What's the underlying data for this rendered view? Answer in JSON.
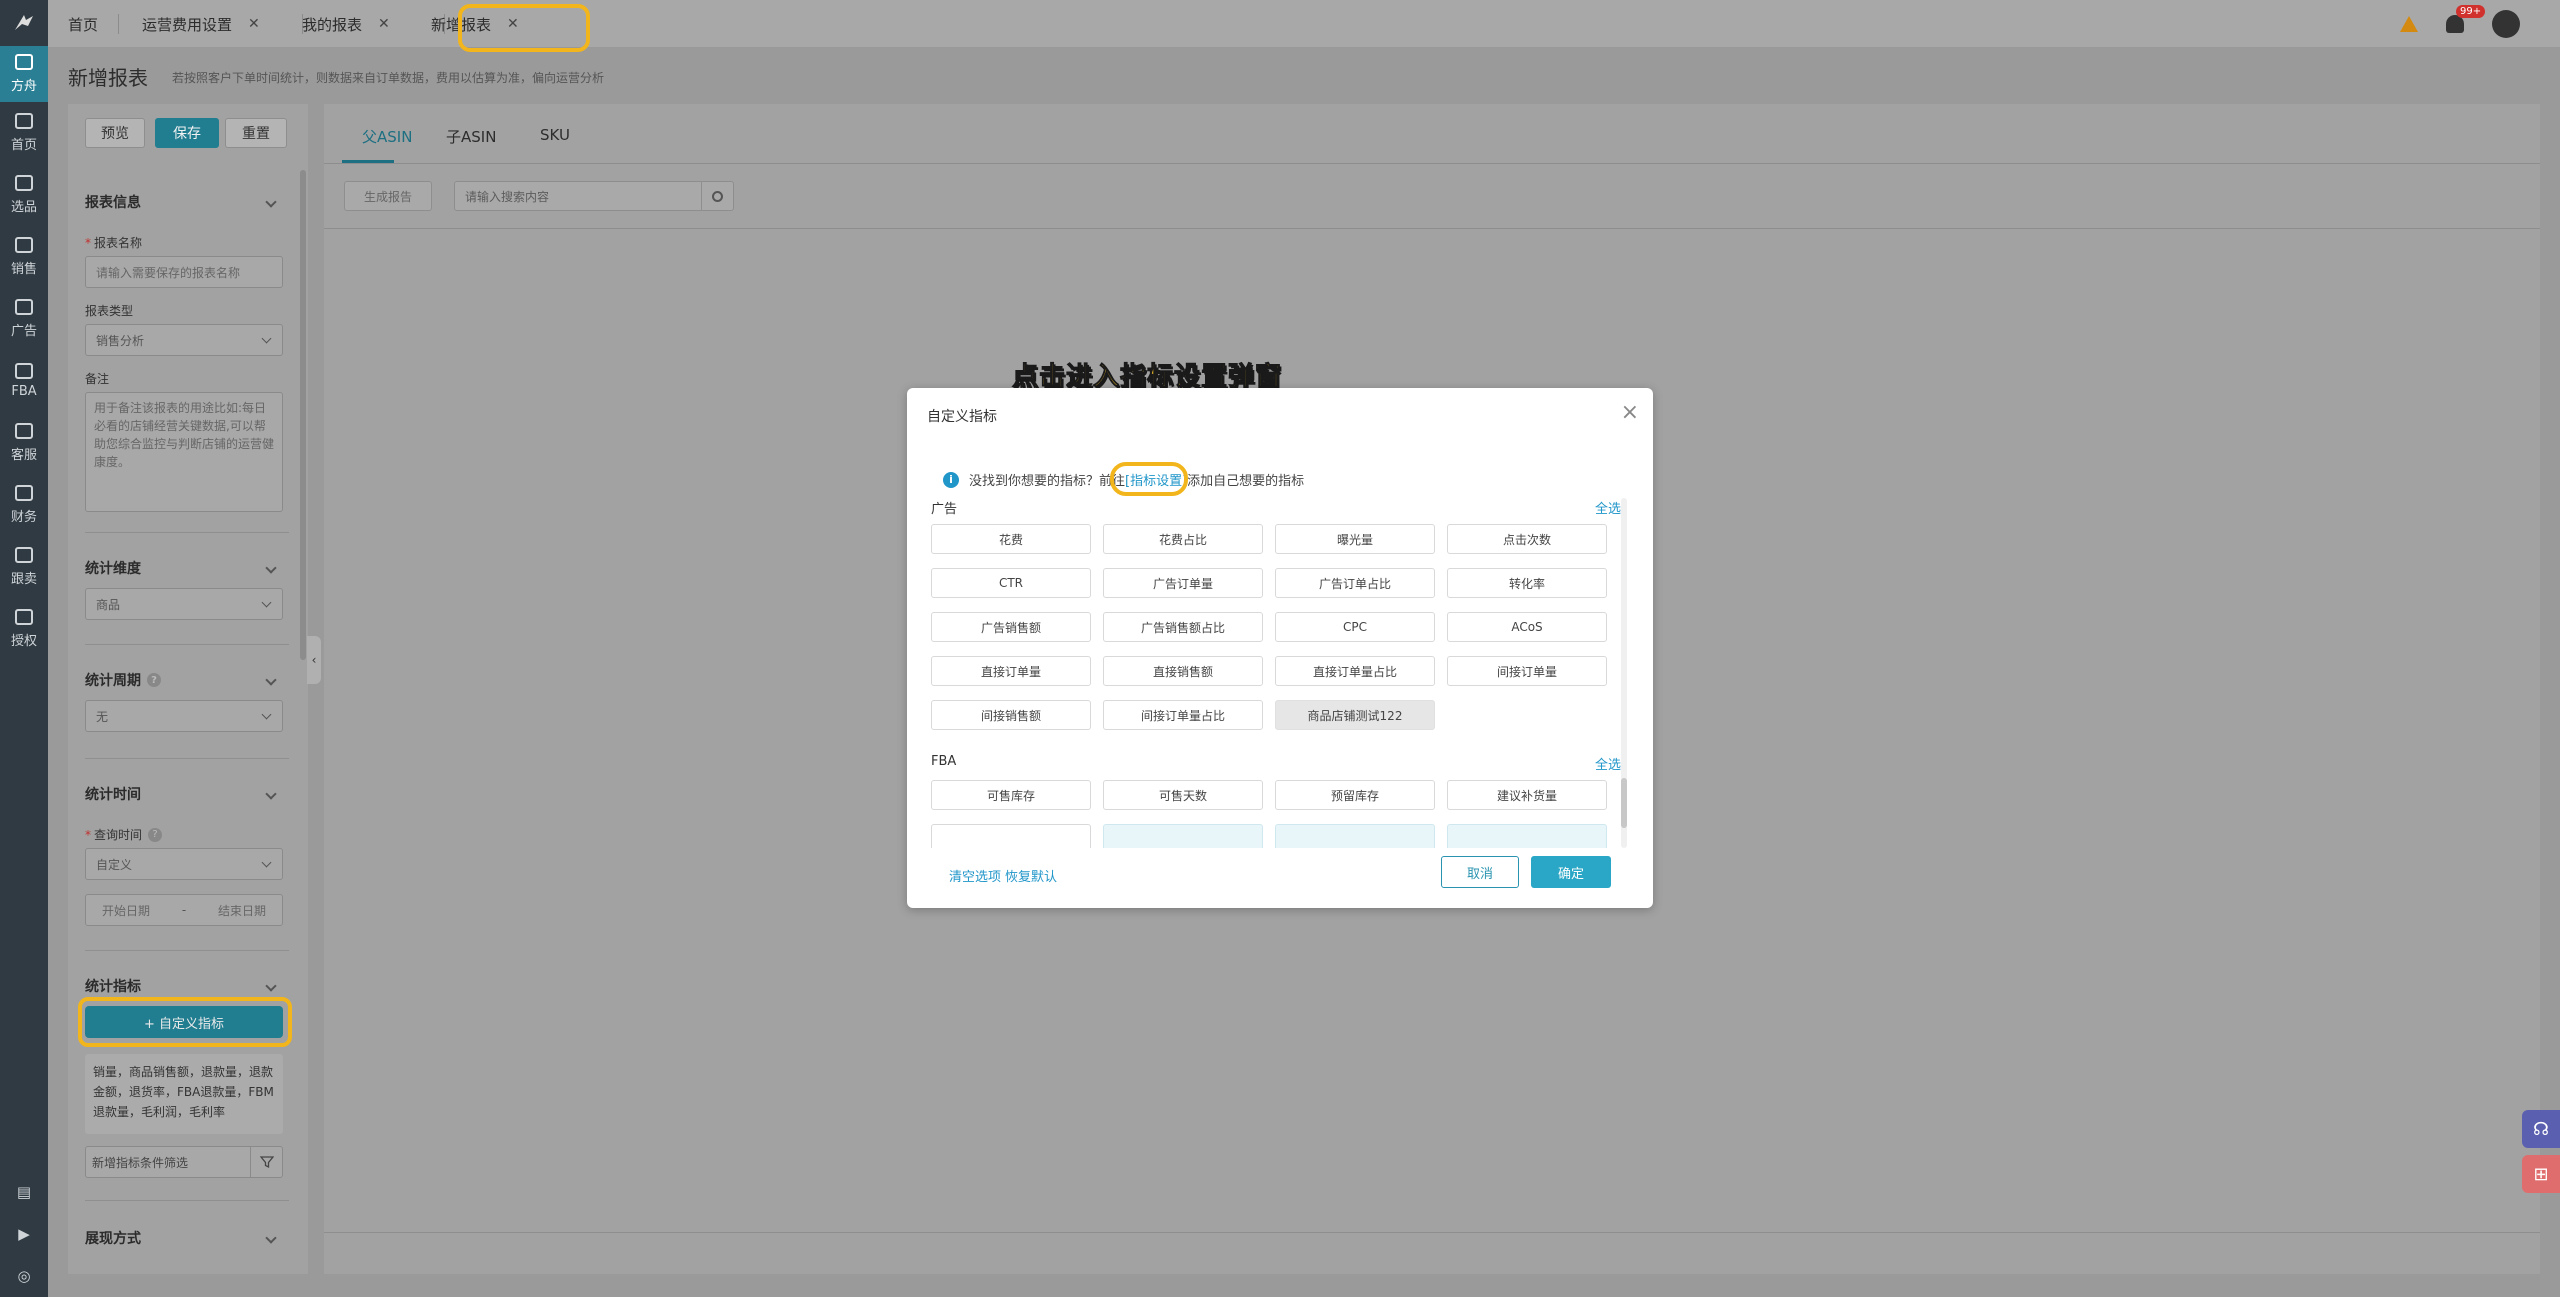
{
  "nav": {
    "logo": "logo-icon",
    "items": [
      {
        "label": "方舟",
        "icon": "ark-icon",
        "active": true
      },
      {
        "label": "首页",
        "icon": "home-icon"
      },
      {
        "label": "选品",
        "icon": "search-icon"
      },
      {
        "label": "销售",
        "icon": "trend-icon"
      },
      {
        "label": "广告",
        "icon": "ad-icon"
      },
      {
        "label": "FBA",
        "icon": "fba-icon"
      },
      {
        "label": "客服",
        "icon": "service-icon"
      },
      {
        "label": "财务",
        "icon": "finance-icon"
      },
      {
        "label": "跟卖",
        "icon": "follow-icon"
      },
      {
        "label": "授权",
        "icon": "auth-icon"
      }
    ]
  },
  "tabs": [
    {
      "label": "首页",
      "closable": false
    },
    {
      "label": "运营费用设置",
      "closable": true
    },
    {
      "label": "我的报表",
      "closable": true
    },
    {
      "label": "新增报表",
      "closable": true,
      "active": true
    }
  ],
  "header": {
    "notif_badge": "99+",
    "page_title": "新增报表",
    "page_desc": "若按照客户下单时间统计，则数据来自订单数据，费用以估算为准，偏向运营分析"
  },
  "left_panel": {
    "preview": "预览",
    "save": "保存",
    "reset": "重置",
    "report_info": "报表信息",
    "report_name_label": "报表名称",
    "report_name_placeholder": "请输入需要保存的报表名称",
    "report_type_label": "报表类型",
    "report_type_value": "销售分析",
    "remark_label": "备注",
    "remark_placeholder": "用于备注该报表的用途比如:每日必看的店铺经营关键数据,可以帮助您综合监控与判断店铺的运营健康度。",
    "dimension_title": "统计维度",
    "dimension_value": "商品",
    "period_title": "统计周期",
    "period_value": "无",
    "time_title": "统计时间",
    "query_time_label": "查询时间",
    "query_time_value": "自定义",
    "start_date": "开始日期",
    "date_sep": "-",
    "end_date": "结束日期",
    "metric_title": "统计指标",
    "custom_metric_btn": "+ 自定义指标",
    "metric_list": "销量，商品销售额，退款量，退款金额，退货率，FBA退款量，FBM退款量，毛利润，毛利率",
    "filter_placeholder": "新增指标条件筛选",
    "display_title": "展现方式"
  },
  "main": {
    "tabs": [
      "父ASIN",
      "子ASIN",
      "SKU"
    ],
    "generate_btn": "生成报告",
    "search_placeholder": "请输入搜索内容"
  },
  "annotation": {
    "text": "点击进入指标设置弹窗"
  },
  "modal": {
    "title": "自定义指标",
    "info_prefix": "没找到你想要的指标？前往",
    "info_link": "[指标设置]",
    "info_suffix": "添加自己想要的指标",
    "groups": [
      {
        "title": "广告",
        "select_all": "全选",
        "items": [
          "花费",
          "花费占比",
          "曝光量",
          "点击次数",
          "CTR",
          "广告订单量",
          "广告订单占比",
          "转化率",
          "广告销售额",
          "广告销售额占比",
          "CPC",
          "ACoS",
          "直接订单量",
          "直接销售额",
          "直接订单量占比",
          "间接订单量",
          "间接销售额",
          "间接订单量占比",
          "商品店铺测试122"
        ],
        "selected_index": 18
      },
      {
        "title": "FBA",
        "select_all": "全选",
        "items": [
          "可售库存",
          "可售天数",
          "预留库存",
          "建议补货量"
        ]
      }
    ],
    "clear": "清空选项",
    "restore": "恢复默认",
    "cancel": "取消",
    "confirm": "确定"
  }
}
